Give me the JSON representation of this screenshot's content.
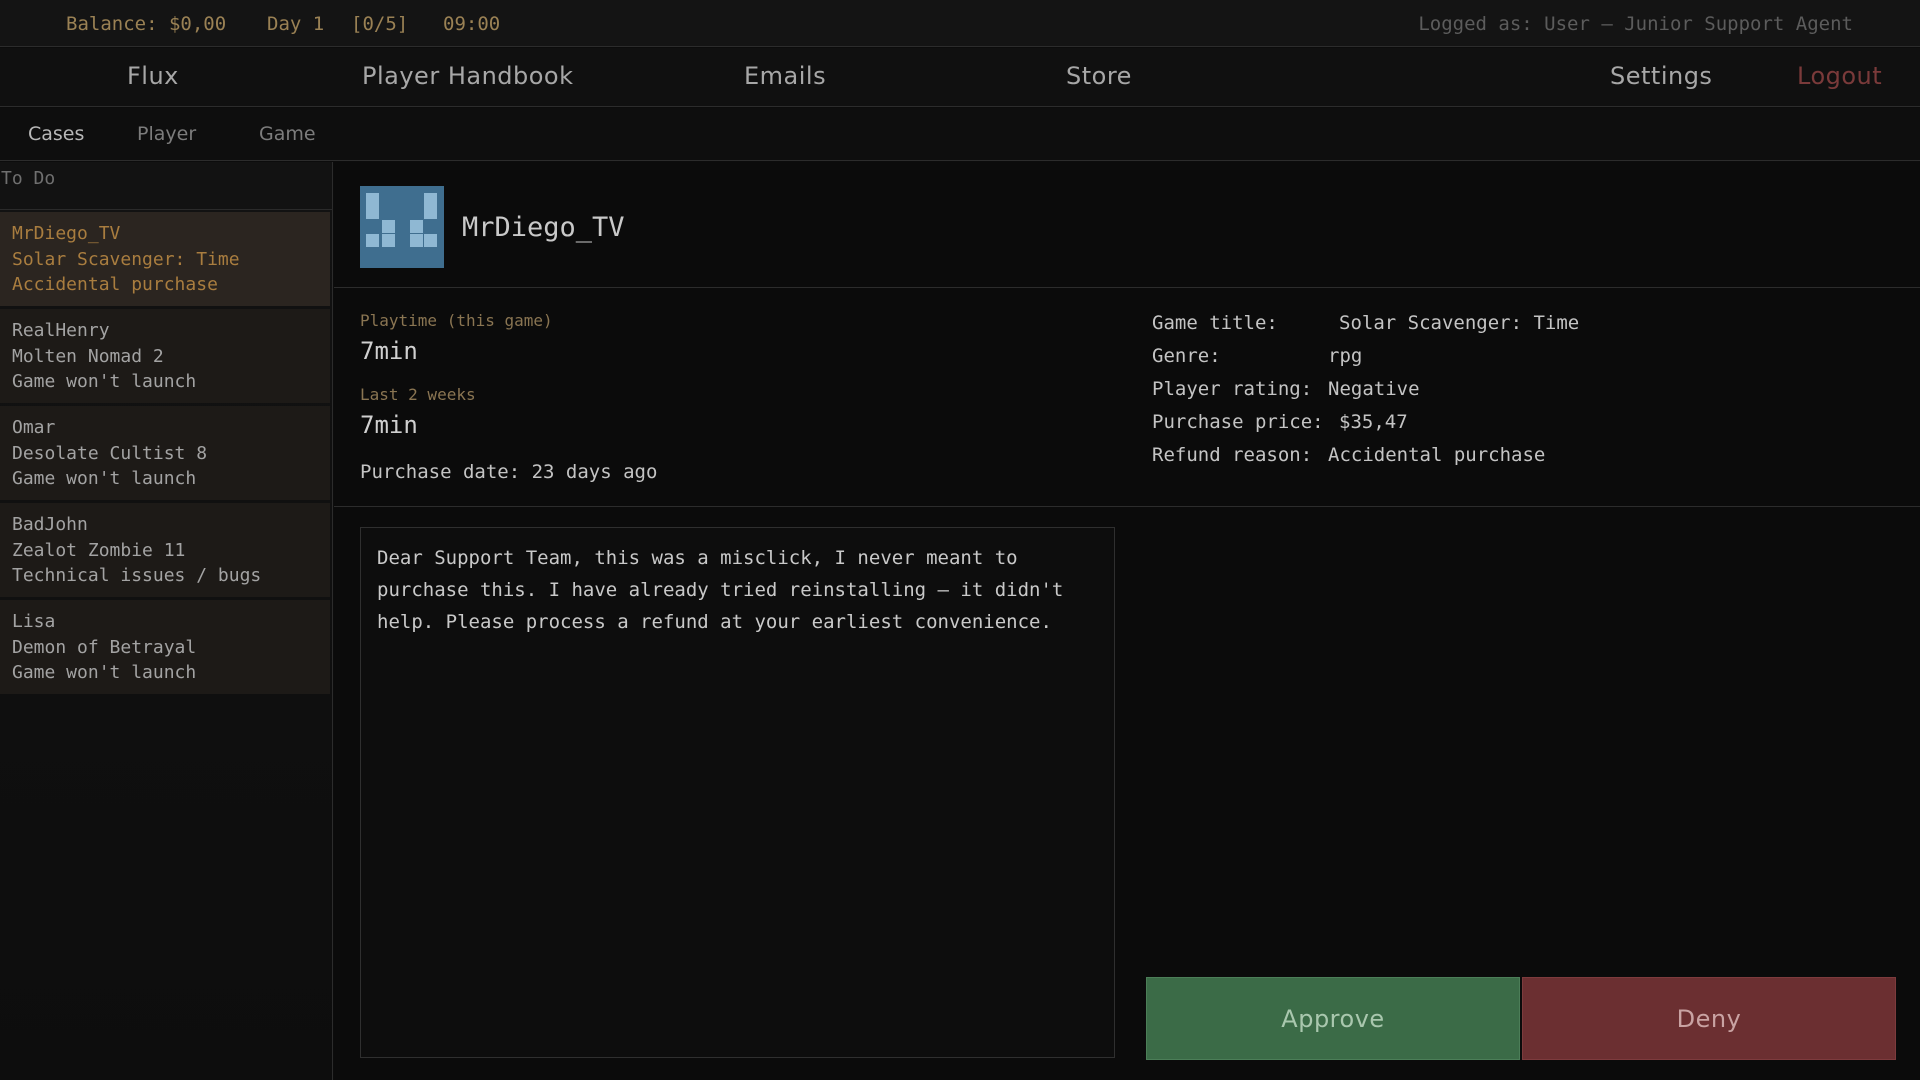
{
  "status": {
    "balance": "Balance: $0,00",
    "day": "Day 1",
    "progress": "[0/5]",
    "time": "09:00",
    "logged_as": "Logged as: User — Junior Support Agent"
  },
  "nav": {
    "flux": "Flux",
    "handbook": "Player Handbook",
    "emails": "Emails",
    "store": "Store",
    "settings": "Settings",
    "logout": "Logout"
  },
  "subnav": {
    "cases": "Cases",
    "player": "Player",
    "game": "Game"
  },
  "sidebar": {
    "header": "To Do",
    "cases": [
      {
        "name": "MrDiego_TV",
        "game": "Solar Scavenger: Time",
        "reason": "Accidental purchase"
      },
      {
        "name": "RealHenry",
        "game": "Molten Nomad 2",
        "reason": "Game won't launch"
      },
      {
        "name": "Omar",
        "game": "Desolate Cultist 8",
        "reason": "Game won't launch"
      },
      {
        "name": "BadJohn",
        "game": "Zealot Zombie 11",
        "reason": "Technical issues / bugs"
      },
      {
        "name": "Lisa",
        "game": "Demon of Betrayal",
        "reason": "Game won't launch"
      }
    ]
  },
  "profile": {
    "username": "MrDiego_TV",
    "avatar_color": "#3f6e8f"
  },
  "stats": {
    "playtime_label": "Playtime (this game)",
    "playtime_value": "7min",
    "last2_label": "Last 2 weeks",
    "last2_value": "7min",
    "purchase_date": "Purchase date: 23 days ago"
  },
  "info": {
    "title_label": "Game title:",
    "title_value": "Solar Scavenger: Time",
    "genre_label": "Genre:",
    "genre_value": "rpg",
    "rating_label": "Player rating:",
    "rating_value": "Negative",
    "price_label": "Purchase price:",
    "price_value": "$35,47",
    "reason_label": "Refund reason:",
    "reason_value": "Accidental purchase"
  },
  "message": "Dear Support Team, this was a misclick, I never meant to purchase this. I have already tried reinstalling — it didn't help. Please process a refund at your earliest convenience.",
  "actions": {
    "approve": "Approve",
    "deny": "Deny"
  },
  "colors": {
    "accent": "#a97d3f",
    "approve": "#3b6b47",
    "deny": "#6b2f31",
    "logout": "#7a3a3a"
  }
}
